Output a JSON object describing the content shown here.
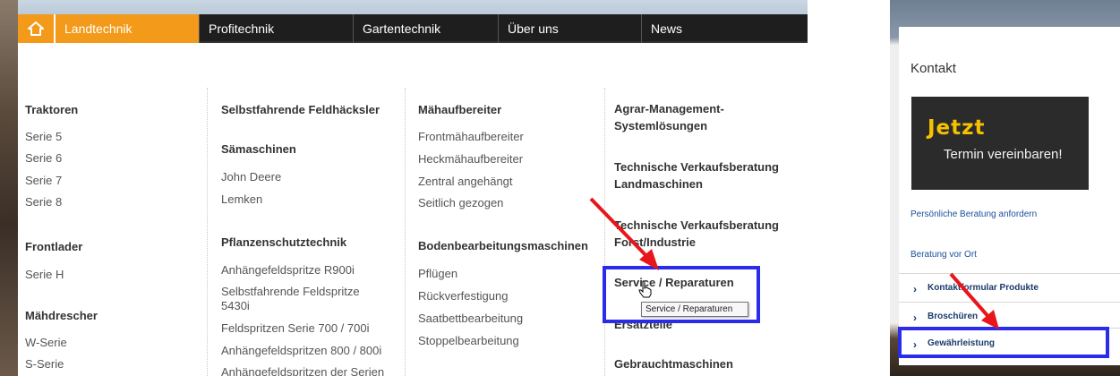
{
  "nav": {
    "home_icon": "home-icon",
    "items": [
      "Landtechnik",
      "Profitechnik",
      "Gartentechnik",
      "Über uns",
      "News"
    ],
    "active_color": "#f39a1a"
  },
  "col1": {
    "traktoren": "Traktoren",
    "traktoren_items": [
      "Serie 5",
      "Serie 6",
      "Serie 7",
      "Serie 8"
    ],
    "frontlader": "Frontlader",
    "frontlader_items": [
      "Serie H"
    ],
    "maehdrescher": "Mähdrescher",
    "maehdrescher_items": [
      "W-Serie",
      "S-Serie"
    ]
  },
  "col2": {
    "feldhaecksler": "Selbstfahrende Feldhäcksler",
    "saemaschinen": "Sämaschinen",
    "saemaschinen_items": [
      "John Deere",
      "Lemken"
    ],
    "pflanzenschutz": "Pflanzenschutztechnik",
    "pflanzenschutz_items": [
      "Anhängefeldspritze R900i",
      "Selbstfahrende Feldspritze",
      "5430i",
      "Feldspritzen Serie 700 / 700i",
      "Anhängefeldspritzen 800 / 800i",
      "Anhängefeldspritzen der Serien"
    ]
  },
  "col3": {
    "maehaufbereiter": "Mähaufbereiter",
    "maehaufbereiter_items": [
      "Frontmähaufbereiter",
      "Heckmähaufbereiter",
      "Zentral angehängt",
      "Seitlich gezogen"
    ],
    "boden": "Bodenbearbeitungsmaschinen",
    "boden_items": [
      "Pflügen",
      "Rückverfestigung",
      "Saatbettbearbeitung",
      "Stoppelbearbeitung"
    ]
  },
  "col4": {
    "agrar1": "Agrar-Management-",
    "agrar2": "Systemlösungen",
    "tvb1": "Technische Verkaufsberatung",
    "tvb1b": "Landmaschinen",
    "tvb2": "Technische Verkaufsberatung",
    "tvb2b": "Forst/Industrie",
    "service": "Service / Reparaturen",
    "ersatzteile": "Ersatzteile",
    "gebraucht": "Gebrauchtmaschinen"
  },
  "tooltip": "Service / Reparaturen",
  "right": {
    "title": "Kontakt",
    "cta_line1": "Jetzt",
    "cta_line2": "Termin vereinbaren!",
    "link1": "Persönliche Beratung anfordern",
    "link2": "Beratung vor Ort",
    "nav_items": [
      "Kontaktformular Produkte",
      "Broschüren",
      "Gewährleistung"
    ]
  },
  "colors": {
    "highlight_box": "#2b2bea",
    "arrow": "#e8161b",
    "link": "#1a4f9c"
  }
}
